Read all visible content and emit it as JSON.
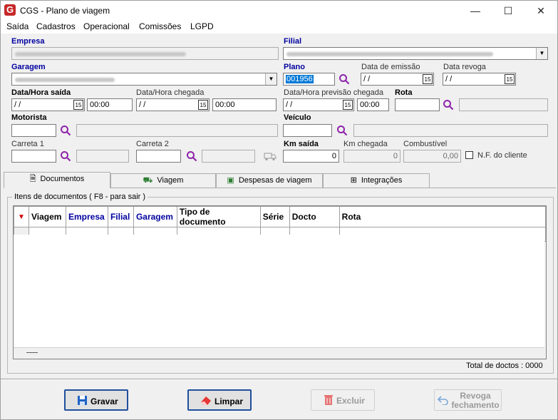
{
  "window": {
    "title": "CGS - Plano de viagem",
    "logo_letter": "G"
  },
  "menu": [
    "Saída",
    "Cadastros",
    "Operacional",
    "Comissões",
    "LGPD"
  ],
  "labels": {
    "empresa": "Empresa",
    "filial": "Filial",
    "garagem": "Garagem",
    "plano": "Plano",
    "data_emissao": "Data de emissão",
    "data_revoga": "Data revoga",
    "data_hora_saida": "Data/Hora saída",
    "data_hora_chegada": "Data/Hora chegada",
    "data_hora_prev_chegada": "Data/Hora previsão chegada",
    "rota": "Rota",
    "motorista": "Motorista",
    "veiculo": "Veículo",
    "carreta1": "Carreta 1",
    "carreta2": "Carreta 2",
    "km_saida": "Km saída",
    "km_chegada": "Km chegada",
    "combustivel": "Combustível",
    "nf_cliente": "N.F. do cliente"
  },
  "values": {
    "plano": "001956",
    "empty_date": "/  /",
    "time_saida": "00:00",
    "time_chegada": "00:00",
    "time_prev": "00:00",
    "km_saida": "0",
    "km_chegada": "0",
    "combustivel": "0,00"
  },
  "tabs": [
    "Documentos",
    "Viagem",
    "Despesas de viagem",
    "Integrações"
  ],
  "group_title": "Itens de documentos ( F8 - para sair )",
  "grid": {
    "columns": [
      "Viagem",
      "Empresa",
      "Filial",
      "Garagem",
      "Tipo de documento",
      "Série",
      "Docto",
      "Rota"
    ],
    "blue_columns": [
      "Empresa",
      "Filial",
      "Garagem"
    ]
  },
  "footer": {
    "total": "Total de doctos : 0000"
  },
  "buttons": {
    "gravar": "Gravar",
    "limpar": "Limpar",
    "excluir": "Excluir",
    "revoga": "Revoga fechamento"
  },
  "colors": {
    "accent": "#1e4f9c",
    "label_blue": "#0000a0",
    "search_icon": "#8e24aa",
    "logo": "#c62828"
  }
}
